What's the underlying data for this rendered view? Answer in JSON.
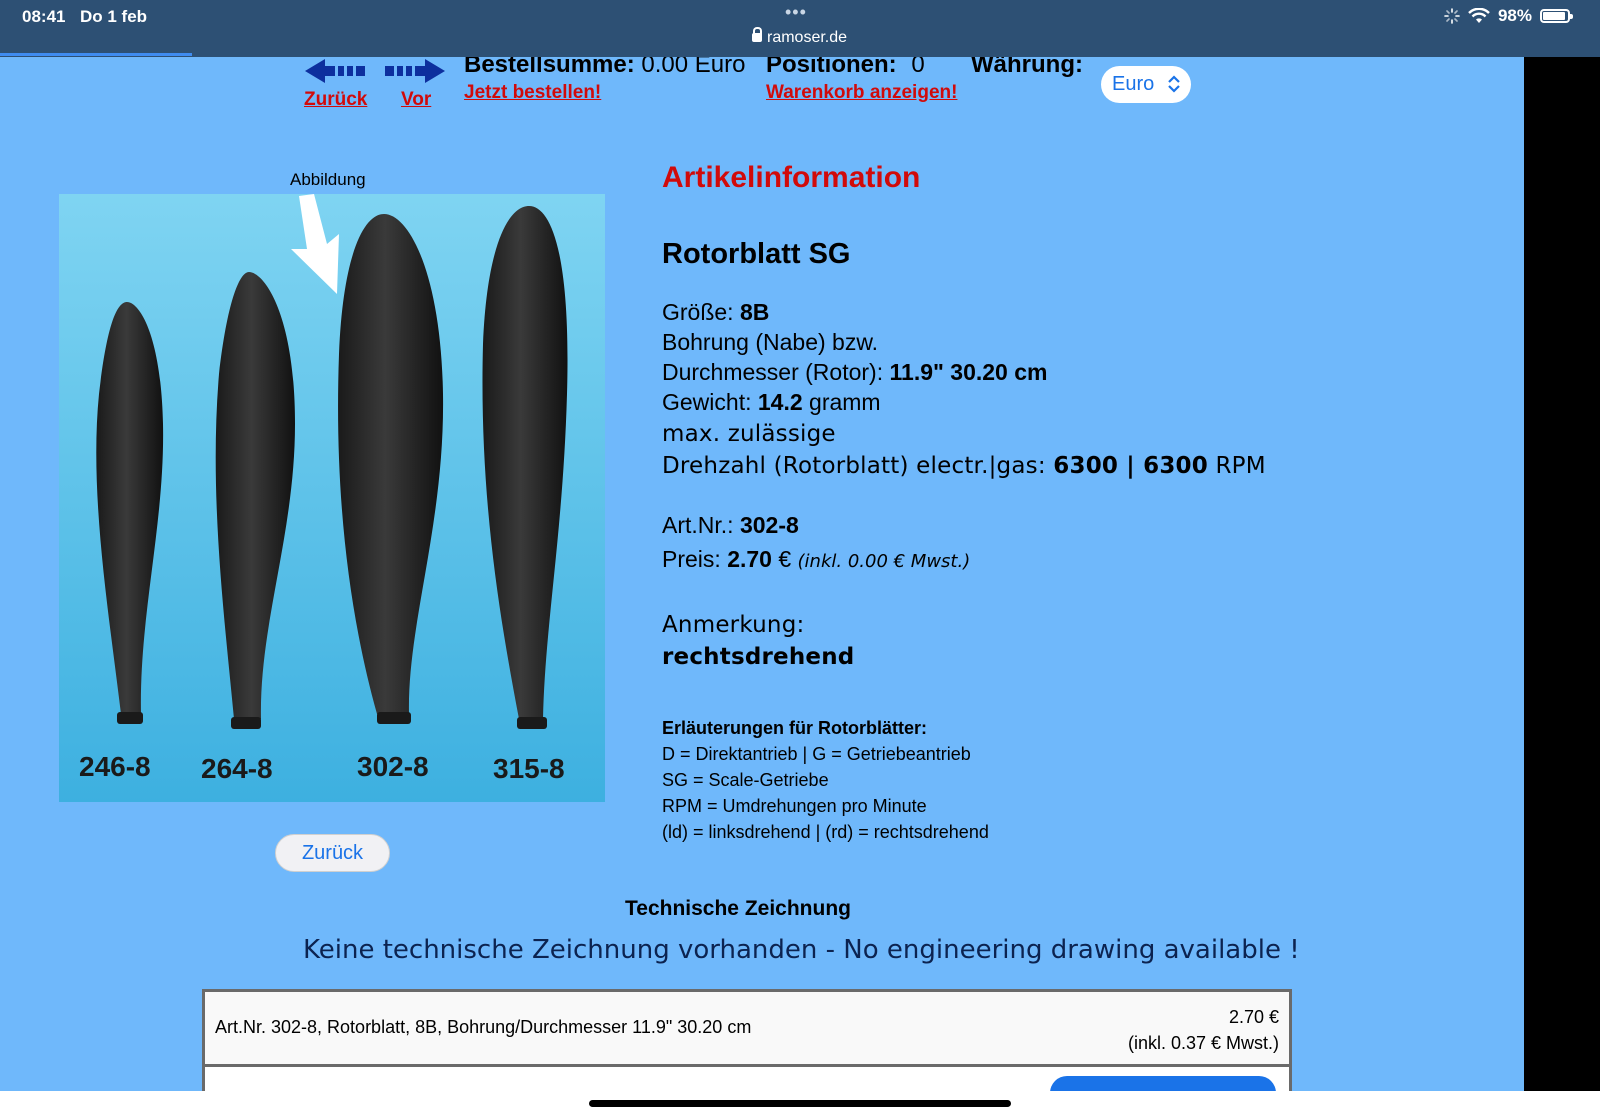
{
  "status_bar": {
    "time": "08:41",
    "date": "Do 1 feb",
    "dots": "•••",
    "url": "ramoser.de",
    "battery": "98%"
  },
  "nav": {
    "back_label": "Zurück",
    "forward_label": "Vor",
    "order_sum_label": "Bestellsumme:",
    "order_sum_value": "0.00 Euro",
    "order_now": "Jetzt bestellen!",
    "positions_label": "Positionen:",
    "positions_value": "0",
    "show_cart": "Warenkorb anzeigen!",
    "currency_label": "Währung:",
    "currency_selected": "Euro"
  },
  "image": {
    "caption": "Abbildung",
    "labels": [
      "246-8",
      "264-8",
      "302-8",
      "315-8"
    ]
  },
  "article": {
    "heading": "Artikelinformation",
    "name": "Rotorblatt SG",
    "size_label": "Größe:",
    "size_value": "8B",
    "bore_line": "Bohrung (Nabe) bzw.",
    "diameter_label": "Durchmesser (Rotor):",
    "diameter_value": "11.9\" 30.20 cm",
    "weight_label": "Gewicht:",
    "weight_value": "14.2",
    "weight_unit": "gramm",
    "max_line": "max. zulässige",
    "rpm_label": "Drehzahl (Rotorblatt) electr.|gas:",
    "rpm_value": "6300 | 6300",
    "rpm_unit": "RPM",
    "artnr_label": "Art.Nr.:",
    "artnr_value": "302-8",
    "price_label": "Preis:",
    "price_value": "2.70",
    "price_currency": "€",
    "price_tax": "(inkl. 0.00 € Mwst.)",
    "note_label": "Anmerkung:",
    "note_value": "rechtsdrehend",
    "legend_title": "Erläuterungen für Rotorblätter:",
    "legend_lines": [
      "D = Direktantrieb | G = Getriebeantrieb",
      "SG = Scale-Getriebe",
      "RPM = Umdrehungen pro Minute",
      "(ld) = linksdrehend | (rd) = rechtsdrehend"
    ]
  },
  "back_button": "Zurück",
  "technical": {
    "title": "Technische Zeichnung",
    "none": "Keine technische Zeichnung vorhanden - No engineering drawing available !"
  },
  "order_table": {
    "description": "Art.Nr. 302-8, Rotorblatt, 8B, Bohrung/Durchmesser 11.9\" 30.20 cm",
    "price": "2.70 €",
    "tax": "(inkl. 0.37 € Mwst.)"
  },
  "colors": {
    "page_bg": "#6fb8fb",
    "link_red": "#d10a0a",
    "button_blue": "#1a73e8",
    "status_bar": "#2d5074"
  }
}
